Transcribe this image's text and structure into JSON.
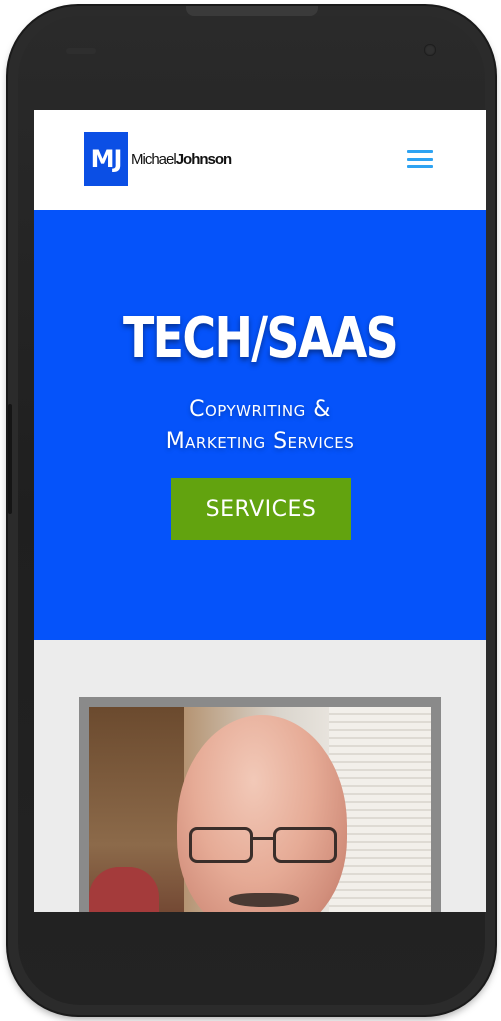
{
  "header": {
    "logo_mark": "MJ",
    "logo_first": "Michael",
    "logo_last": "Johnson"
  },
  "hero": {
    "title": "TECH/SAAS",
    "subtitle_line1": "Copywriting &",
    "subtitle_line2": "Marketing Services",
    "button_label": "SERVICES"
  },
  "colors": {
    "brand_blue": "#0553fa",
    "button_green": "#62a30f",
    "menu_icon": "#2ea3f2",
    "section_bg": "#ececec"
  },
  "icons": {
    "menu": "hamburger-menu-icon"
  }
}
